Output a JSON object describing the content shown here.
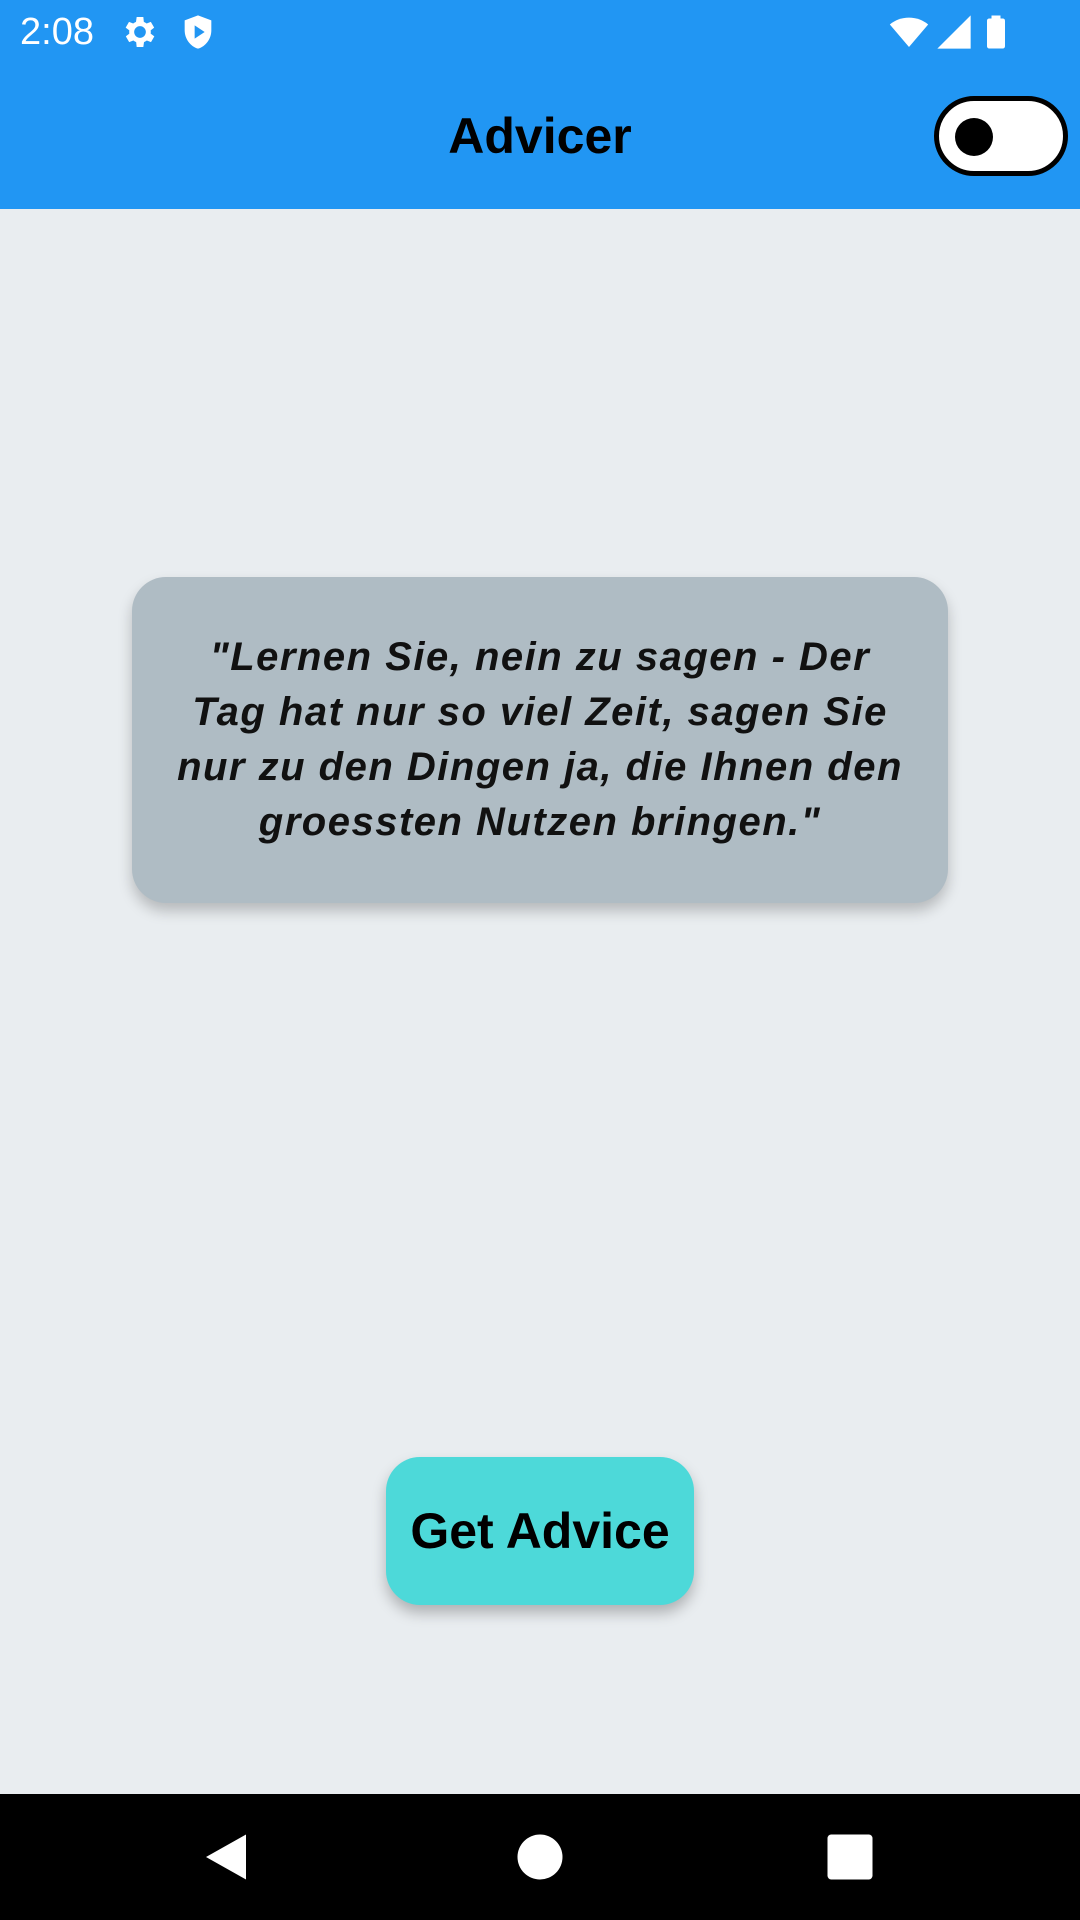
{
  "status_bar": {
    "time": "2:08",
    "icons": [
      "gear-icon",
      "shield-play-icon",
      "wifi-icon",
      "signal-icon",
      "battery-icon"
    ],
    "background": "#2196F3"
  },
  "app_bar": {
    "title": "Advicer",
    "theme_toggle_state": "off",
    "background": "#2196F3"
  },
  "advice_card": {
    "text": "\"Lernen Sie, nein zu sagen - Der Tag hat nur so viel Zeit, sagen Sie nur zu den Dingen ja, die Ihnen den groessten Nutzen bringen.\"",
    "background": "#AFBCC4"
  },
  "actions": {
    "get_advice_label": "Get Advice",
    "button_color": "#4DD9D9"
  },
  "nav_bar": {
    "buttons": [
      "back-icon",
      "home-icon",
      "recents-icon"
    ]
  }
}
